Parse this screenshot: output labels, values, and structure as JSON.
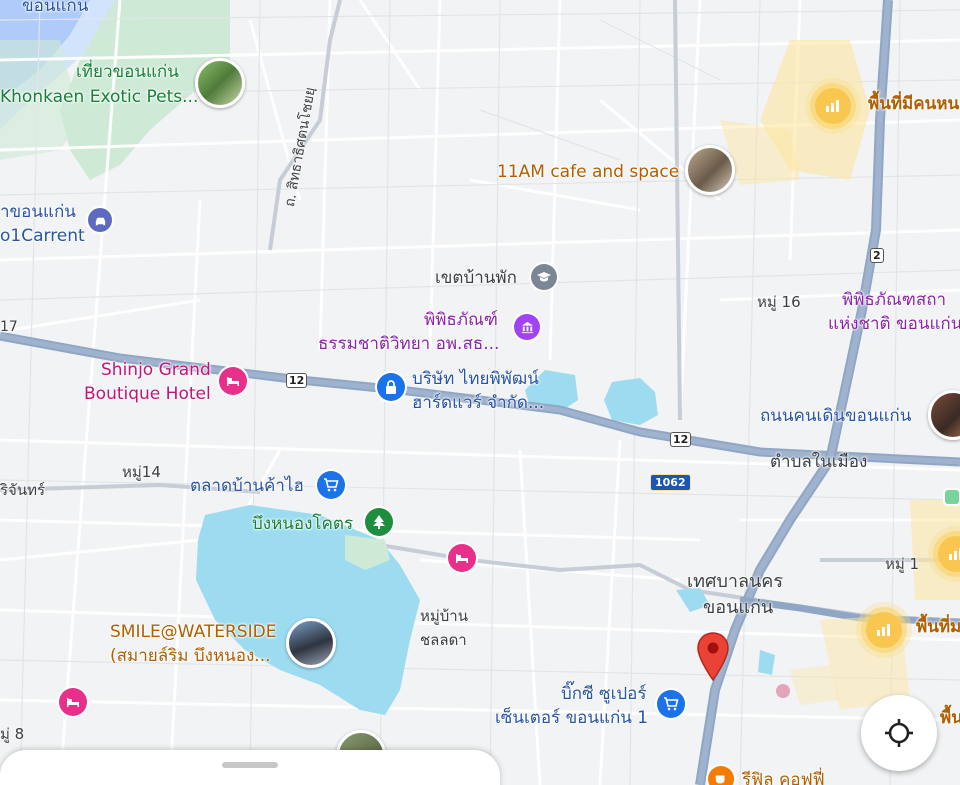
{
  "map": {
    "labels": {
      "khon_kaen_top": "ขอนแก่น",
      "tour_khon_kaen": "เที่ยวขอนแก่น",
      "exotic_pets": "Khonkaen Exotic Pets...",
      "road_sirat": "ถ. สิทธาธิศตนโชยยฺ",
      "car_rent_thai": "าขอนแก่น",
      "car_rent_en": "o1Carrent",
      "cafe": "11AM cafe and space",
      "zone_people_1": "พื้นที่มีคนหน",
      "khet_ban_phak": "เขตบ้านพัก",
      "museum1_l1": "พิพิธภัณฑ์",
      "museum1_l2": "ธรรมชาติวิทยา อพ.สธ...",
      "moo16": "หมู่ 16",
      "museum2_l1": "พิพิธภัณฑสถา",
      "museum2_l2": "แห่งชาติ ขอนแก่น",
      "road_17": "17",
      "hotel_l1": "Shinjo Grand",
      "hotel_l2": "Boutique Hotel",
      "company_l1": "บริษัท ไทยพิพัฒน์",
      "company_l2": "ฮาร์ดแวร์ จำกัด...",
      "walking_street": "ถนนคนเดินขอนแก่น",
      "tambon_nai_mueang": "ตำบลในเมือง",
      "moo14": "หมู่14",
      "chan_left": "ริจันทร์",
      "market": "ตลาดบ้านค้าไฮ",
      "bueng_nong_khot": "บึงหนองโคตร",
      "municipality_l1": "เทศบาลนคร",
      "municipality_l2": "ขอนแก่น",
      "moo1": "หมู่ 1",
      "zone_people_2": "พื้นที่ม",
      "zone_people_3": "พื้น",
      "village_l1": "หมู่บ้าน",
      "village_l2": "ชลลดา",
      "smile_l1": "SMILE@WATERSIDE",
      "smile_l2": "(สมายล์ริม บึงหนอง...",
      "bigc_l1": "บิ๊กซี ซูเปอร์",
      "bigc_l2": "เซ็นเตอร์ ขอนแก่น 1",
      "moo8": "มู่ 8",
      "coffee_partial": "รีฟิล คอฟฟี่"
    },
    "shields": {
      "r12_a": "12",
      "r12_b": "12",
      "r2": "2",
      "r1062": "1062"
    },
    "colors": {
      "water": "#9ddcf0",
      "major_road": "#8fa6c4",
      "pin": "#ea4335"
    }
  },
  "controls": {
    "locate_icon": "crosshair-icon"
  }
}
